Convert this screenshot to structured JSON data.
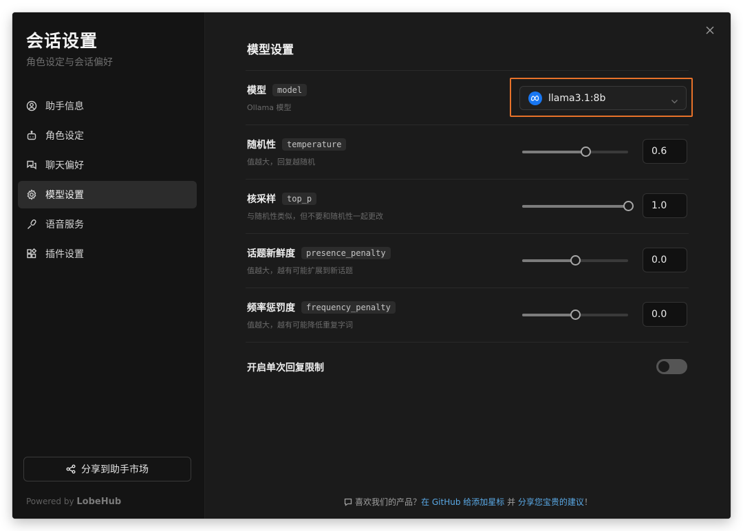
{
  "sidebar": {
    "title": "会话设置",
    "subtitle": "角色设定与会话偏好",
    "items": [
      {
        "label": "助手信息",
        "icon": "user-circle-icon",
        "active": false
      },
      {
        "label": "角色设定",
        "icon": "robot-icon",
        "active": false
      },
      {
        "label": "聊天偏好",
        "icon": "chat-bubbles-icon",
        "active": false
      },
      {
        "label": "模型设置",
        "icon": "gear-icon",
        "active": true
      },
      {
        "label": "语音服务",
        "icon": "microphone-icon",
        "active": false
      },
      {
        "label": "插件设置",
        "icon": "blocks-icon",
        "active": false
      }
    ],
    "share_button": "分享到助手市场",
    "powered_prefix": "Powered by",
    "powered_brand": "LobeHub"
  },
  "main": {
    "section_title": "模型设置",
    "model": {
      "label": "模型",
      "tag": "model",
      "desc": "Ollama 模型",
      "selected": "llama3.1:8b",
      "provider_icon": "meta-icon",
      "highlight_color": "#e8722a"
    },
    "params": [
      {
        "label": "随机性",
        "tag": "temperature",
        "desc": "值越大，回复越随机",
        "value": "0.6",
        "fraction": 0.6
      },
      {
        "label": "核采样",
        "tag": "top_p",
        "desc": "与随机性类似，但不要和随机性一起更改",
        "value": "1.0",
        "fraction": 1.0
      },
      {
        "label": "话题新鲜度",
        "tag": "presence_penalty",
        "desc": "值越大，越有可能扩展到新话题",
        "value": "0.0",
        "fraction": 0.5
      },
      {
        "label": "频率惩罚度",
        "tag": "frequency_penalty",
        "desc": "值越大，越有可能降低重复字词",
        "value": "0.0",
        "fraction": 0.5
      }
    ],
    "toggle": {
      "label": "开启单次回复限制",
      "on": false
    }
  },
  "footer": {
    "text1": "喜欢我们的产品？",
    "link1": "在 GitHub 给添加星标",
    "text2": " 并 ",
    "link2": "分享您宝贵的建议",
    "text3": "！"
  }
}
